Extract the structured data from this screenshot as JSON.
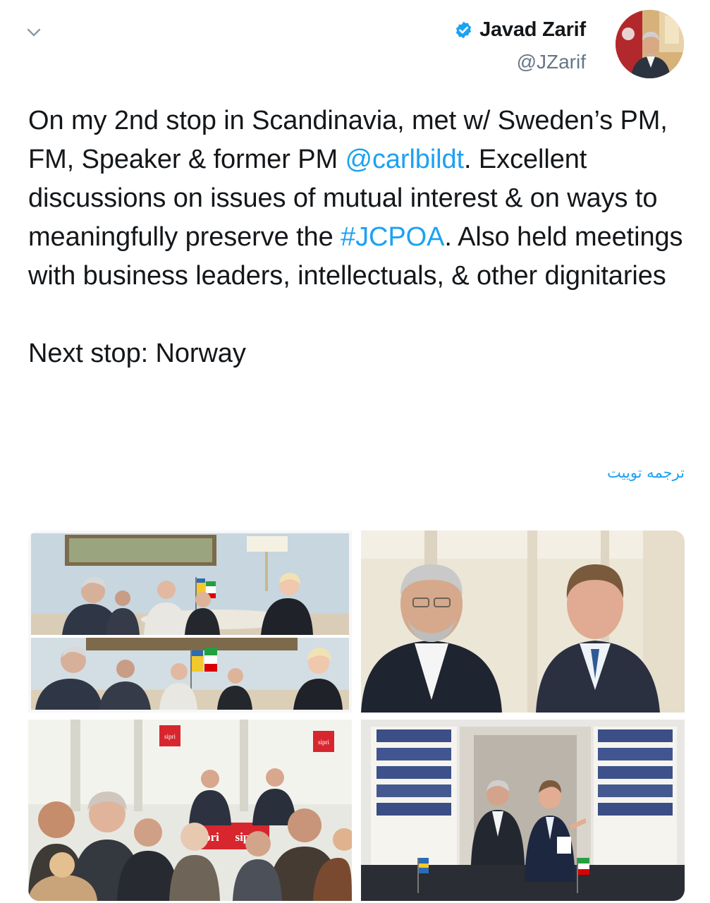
{
  "header": {
    "chevron_icon": "chevron-down-icon",
    "display_name": "Javad Zarif",
    "handle": "@JZarif",
    "verified_icon": "verified-badge-icon",
    "verified_color": "#1da1f2"
  },
  "tweet": {
    "segments": {
      "s1": "On my 2nd stop in Scandinavia, met w/ Sweden’s PM, FM, Speaker & former PM ",
      "mention": "@carlbildt",
      "s2": ". Excellent discussions on issues of mutual interest & on ways to meaningfully preserve the ",
      "hashtag": "#JCPOA",
      "s3": ". Also held meetings with business leaders, intellectuals, & other dignitaries"
    },
    "next_stop": "Next stop: Norway",
    "translate_label": "ترجمه توییت",
    "link_color": "#1da1f2"
  },
  "media": {
    "photo_1": {
      "sign_left": "",
      "sign_right": ""
    },
    "photo_3": {
      "sign_top_left": "sipri",
      "sign_top_right": "sipri",
      "sign_bottom_left": "pri",
      "sign_bottom_right": "sipri"
    }
  }
}
